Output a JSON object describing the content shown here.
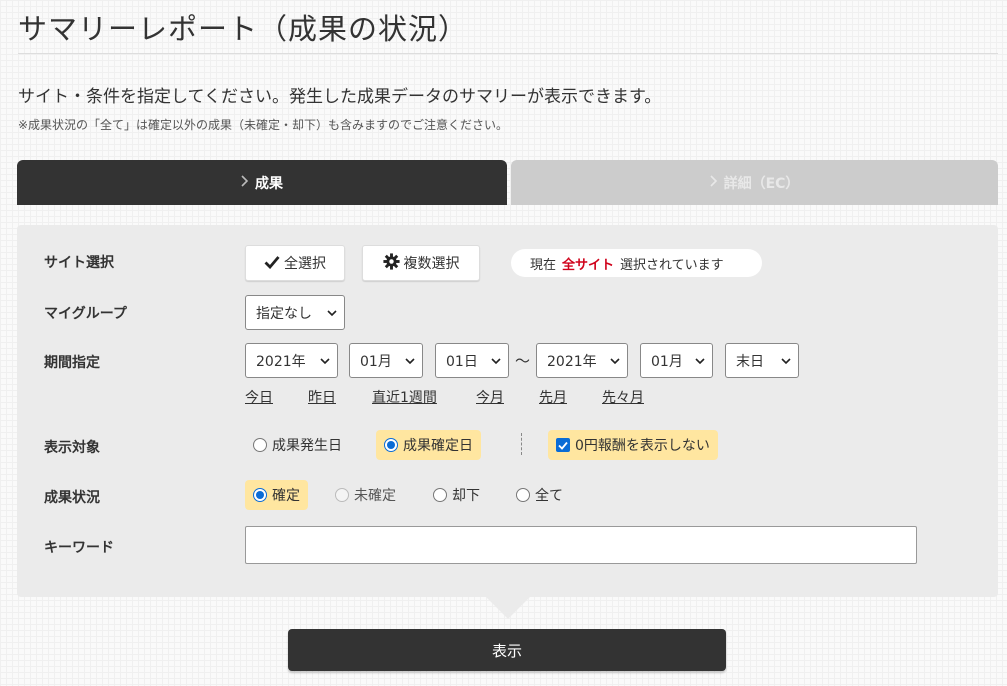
{
  "page": {
    "title": "サマリーレポート（成果の状況）",
    "intro": "サイト・条件を指定してください。発生した成果データのサマリーが表示できます。",
    "note": "※成果状況の「全て」は確定以外の成果（未確定・却下）も含みますのでご注意ください。"
  },
  "tabs": [
    {
      "label": "成果",
      "active": true
    },
    {
      "label": "詳細（EC）",
      "active": false
    }
  ],
  "site": {
    "label": "サイト選択",
    "select_all": "全選択",
    "multi_select": "複数選択",
    "status_prefix": "現在",
    "status_highlight": "全サイト",
    "status_suffix": "選択されています",
    "highlight_color": "#d0021b"
  },
  "mygroup": {
    "label": "マイグループ",
    "value": "指定なし"
  },
  "period": {
    "label": "期間指定",
    "from_year": "2021年",
    "from_month": "01月",
    "from_day": "01日",
    "separator": "～",
    "to_year": "2021年",
    "to_month": "01月",
    "to_day": "末日",
    "quick_links": [
      "今日",
      "昨日",
      "直近1週間",
      "今月",
      "先月",
      "先々月"
    ]
  },
  "display_target": {
    "label": "表示対象",
    "options": [
      {
        "label": "成果発生日",
        "selected": false
      },
      {
        "label": "成果確定日",
        "selected": true
      }
    ],
    "checkbox_label": "0円報酬を表示しない",
    "checkbox_checked": true
  },
  "result_status": {
    "label": "成果状況",
    "options": [
      {
        "label": "確定",
        "selected": true,
        "disabled": false
      },
      {
        "label": "未確定",
        "selected": false,
        "disabled": true
      },
      {
        "label": "却下",
        "selected": false,
        "disabled": false
      },
      {
        "label": "全て",
        "selected": false,
        "disabled": false
      }
    ]
  },
  "keyword": {
    "label": "キーワード",
    "value": "",
    "placeholder": ""
  },
  "submit_label": "表示",
  "colors": {
    "accent_dark": "#333333",
    "highlight_bg": "#ffe6a0",
    "radio_blue": "#0a6cd6",
    "panel_bg": "#ebebeb"
  }
}
